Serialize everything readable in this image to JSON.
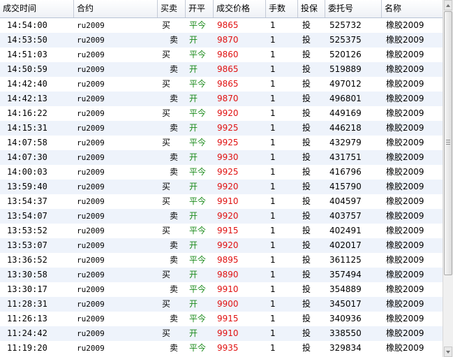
{
  "columns": [
    "成交时间",
    "合约",
    "买卖",
    "开平",
    "成交价格",
    "手数",
    "投保",
    "委托号",
    "名称"
  ],
  "rows": [
    {
      "time": "14:54:00",
      "contract": "ru2009",
      "side": "买",
      "oc": "平今",
      "price": "9865",
      "qty": "1",
      "hedge": "投",
      "order": "525732",
      "name": "橡胶2009"
    },
    {
      "time": "14:53:50",
      "contract": "ru2009",
      "side": "卖",
      "oc": "开",
      "price": "9870",
      "qty": "1",
      "hedge": "投",
      "order": "525375",
      "name": "橡胶2009"
    },
    {
      "time": "14:51:03",
      "contract": "ru2009",
      "side": "买",
      "oc": "平今",
      "price": "9860",
      "qty": "1",
      "hedge": "投",
      "order": "520126",
      "name": "橡胶2009"
    },
    {
      "time": "14:50:59",
      "contract": "ru2009",
      "side": "卖",
      "oc": "开",
      "price": "9865",
      "qty": "1",
      "hedge": "投",
      "order": "519889",
      "name": "橡胶2009"
    },
    {
      "time": "14:42:40",
      "contract": "ru2009",
      "side": "买",
      "oc": "平今",
      "price": "9865",
      "qty": "1",
      "hedge": "投",
      "order": "497012",
      "name": "橡胶2009"
    },
    {
      "time": "14:42:13",
      "contract": "ru2009",
      "side": "卖",
      "oc": "开",
      "price": "9870",
      "qty": "1",
      "hedge": "投",
      "order": "496801",
      "name": "橡胶2009"
    },
    {
      "time": "14:16:22",
      "contract": "ru2009",
      "side": "买",
      "oc": "平今",
      "price": "9920",
      "qty": "1",
      "hedge": "投",
      "order": "449169",
      "name": "橡胶2009"
    },
    {
      "time": "14:15:31",
      "contract": "ru2009",
      "side": "卖",
      "oc": "开",
      "price": "9925",
      "qty": "1",
      "hedge": "投",
      "order": "446218",
      "name": "橡胶2009"
    },
    {
      "time": "14:07:58",
      "contract": "ru2009",
      "side": "买",
      "oc": "平今",
      "price": "9925",
      "qty": "1",
      "hedge": "投",
      "order": "432979",
      "name": "橡胶2009"
    },
    {
      "time": "14:07:30",
      "contract": "ru2009",
      "side": "卖",
      "oc": "开",
      "price": "9930",
      "qty": "1",
      "hedge": "投",
      "order": "431751",
      "name": "橡胶2009"
    },
    {
      "time": "14:00:03",
      "contract": "ru2009",
      "side": "卖",
      "oc": "平今",
      "price": "9925",
      "qty": "1",
      "hedge": "投",
      "order": "416796",
      "name": "橡胶2009"
    },
    {
      "time": "13:59:40",
      "contract": "ru2009",
      "side": "买",
      "oc": "开",
      "price": "9920",
      "qty": "1",
      "hedge": "投",
      "order": "415790",
      "name": "橡胶2009"
    },
    {
      "time": "13:54:37",
      "contract": "ru2009",
      "side": "买",
      "oc": "平今",
      "price": "9910",
      "qty": "1",
      "hedge": "投",
      "order": "404597",
      "name": "橡胶2009"
    },
    {
      "time": "13:54:07",
      "contract": "ru2009",
      "side": "卖",
      "oc": "开",
      "price": "9920",
      "qty": "1",
      "hedge": "投",
      "order": "403757",
      "name": "橡胶2009"
    },
    {
      "time": "13:53:52",
      "contract": "ru2009",
      "side": "买",
      "oc": "平今",
      "price": "9915",
      "qty": "1",
      "hedge": "投",
      "order": "402491",
      "name": "橡胶2009"
    },
    {
      "time": "13:53:07",
      "contract": "ru2009",
      "side": "卖",
      "oc": "开",
      "price": "9920",
      "qty": "1",
      "hedge": "投",
      "order": "402017",
      "name": "橡胶2009"
    },
    {
      "time": "13:36:52",
      "contract": "ru2009",
      "side": "卖",
      "oc": "平今",
      "price": "9895",
      "qty": "1",
      "hedge": "投",
      "order": "361125",
      "name": "橡胶2009"
    },
    {
      "time": "13:30:58",
      "contract": "ru2009",
      "side": "买",
      "oc": "开",
      "price": "9890",
      "qty": "1",
      "hedge": "投",
      "order": "357494",
      "name": "橡胶2009"
    },
    {
      "time": "13:30:17",
      "contract": "ru2009",
      "side": "卖",
      "oc": "平今",
      "price": "9910",
      "qty": "1",
      "hedge": "投",
      "order": "354889",
      "name": "橡胶2009"
    },
    {
      "time": "11:28:31",
      "contract": "ru2009",
      "side": "买",
      "oc": "开",
      "price": "9900",
      "qty": "1",
      "hedge": "投",
      "order": "345017",
      "name": "橡胶2009"
    },
    {
      "time": "11:26:13",
      "contract": "ru2009",
      "side": "卖",
      "oc": "平今",
      "price": "9915",
      "qty": "1",
      "hedge": "投",
      "order": "340936",
      "name": "橡胶2009"
    },
    {
      "time": "11:24:42",
      "contract": "ru2009",
      "side": "买",
      "oc": "开",
      "price": "9910",
      "qty": "1",
      "hedge": "投",
      "order": "338550",
      "name": "橡胶2009"
    },
    {
      "time": "11:19:20",
      "contract": "ru2009",
      "side": "卖",
      "oc": "平今",
      "price": "9935",
      "qty": "1",
      "hedge": "投",
      "order": "329834",
      "name": "橡胶2009"
    }
  ],
  "colors": {
    "price": "#e01010",
    "offset": "#1a8a1a",
    "alt_row": "#eef3fb"
  },
  "icons": {
    "scroll_up": "scroll-up-arrow-icon",
    "scroll_down": "scroll-down-arrow-icon"
  }
}
